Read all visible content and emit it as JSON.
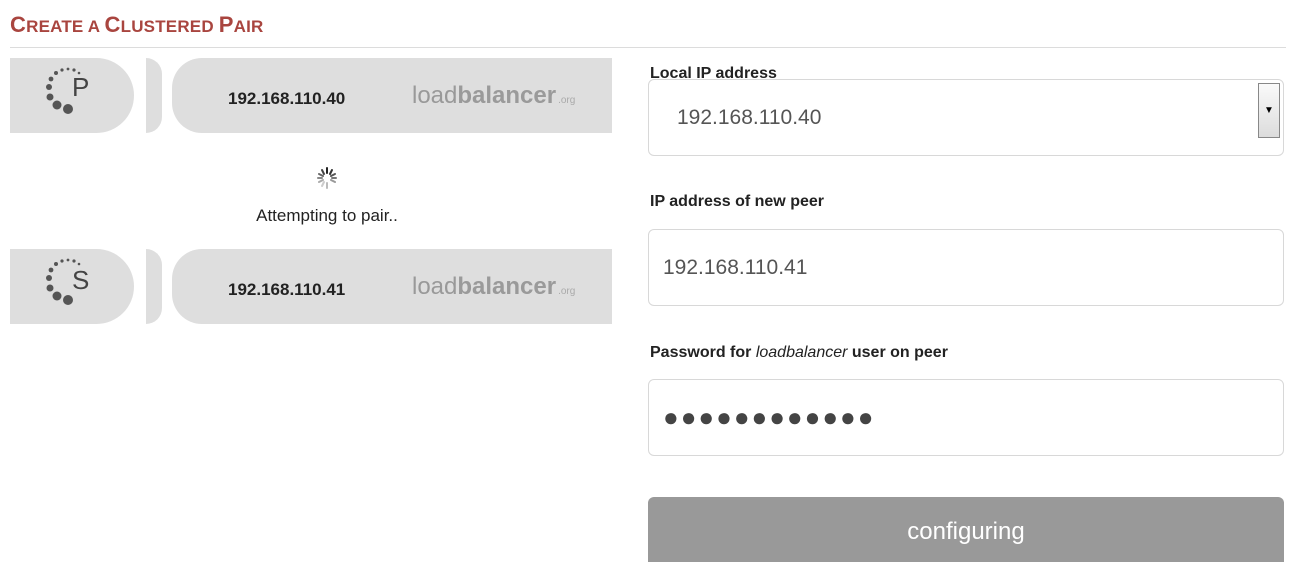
{
  "title": {
    "first_big": "C",
    "rest1": "REATE A ",
    "second_big": "C",
    "rest2": "LUSTERED ",
    "third_big": "P",
    "rest3": "AIR"
  },
  "primary": {
    "letter": "P",
    "ip": "192.168.110.40",
    "brand_plain": "load",
    "brand_bold": "balancer",
    "brand_suffix": ".org"
  },
  "secondary": {
    "letter": "S",
    "ip": "192.168.110.41",
    "brand_plain": "load",
    "brand_bold": "balancer",
    "brand_suffix": ".org"
  },
  "status_text": "Attempting to pair..",
  "form": {
    "local_ip_label": "Local IP address",
    "local_ip_value": "192.168.110.40",
    "peer_ip_label": "IP address of new peer",
    "peer_ip_value": "192.168.110.41",
    "password_label_pre": "Password for ",
    "password_label_em": "loadbalancer",
    "password_label_post": " user on peer",
    "password_value": "●●●●●●●●●●●●"
  },
  "button_label": "configuring",
  "colors": {
    "title": "#a9453f",
    "card": "#dedede",
    "button": "#999999"
  }
}
